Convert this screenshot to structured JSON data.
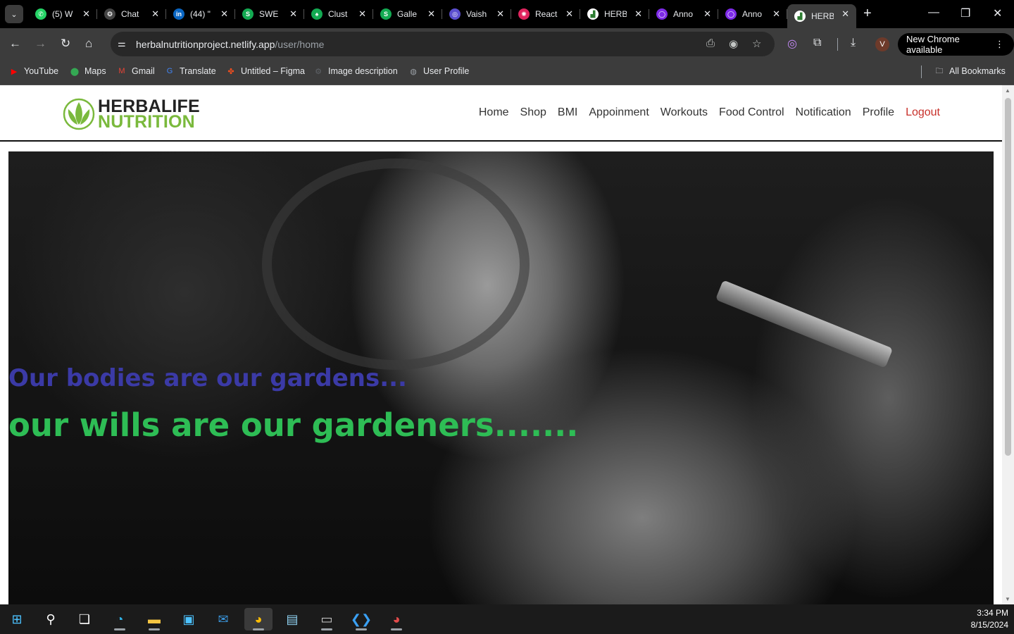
{
  "browser": {
    "tabs": [
      {
        "title": "(5) W",
        "icon": "whatsapp-icon",
        "color": "#25d366",
        "glyph": "✆"
      },
      {
        "title": "Chat",
        "icon": "chatgpt-icon",
        "color": "#444444",
        "glyph": "❂"
      },
      {
        "title": "(44) \"",
        "icon": "linkedin-icon",
        "color": "#0a66c2",
        "glyph": "in"
      },
      {
        "title": "SWE",
        "icon": "mongodb-leaf-icon",
        "color": "#13aa52",
        "glyph": "S"
      },
      {
        "title": "Clust",
        "icon": "mongodb-leaf-icon",
        "color": "#13aa52",
        "glyph": "♠"
      },
      {
        "title": "Galle",
        "icon": "mongodb-leaf-icon",
        "color": "#13aa52",
        "glyph": "S"
      },
      {
        "title": "Vaish",
        "icon": "logo-icon",
        "color": "#5b4fcf",
        "glyph": "◎"
      },
      {
        "title": "React",
        "icon": "react-icon",
        "color": "#e0245e",
        "glyph": "✺"
      },
      {
        "title": "HERB",
        "icon": "herbalife-favicon",
        "color": "#ffffff",
        "glyph": "▟"
      },
      {
        "title": "Anno",
        "icon": "canva-icon",
        "color": "#7d2ae8",
        "glyph": "◯"
      },
      {
        "title": "Anno",
        "icon": "canva-icon",
        "color": "#7d2ae8",
        "glyph": "◯"
      },
      {
        "title": "HERB",
        "icon": "herbalife-favicon",
        "color": "#ffffff",
        "glyph": "▟",
        "active": true
      }
    ],
    "url_host": "herbalnutritionproject.netlify.app",
    "url_path": "/user/home",
    "profile_initial": "V",
    "new_chrome_label": "New Chrome available",
    "bookmarks": [
      {
        "label": "YouTube",
        "icon": "youtube-icon",
        "color": "#ff0000",
        "glyph": "▶"
      },
      {
        "label": "Maps",
        "icon": "maps-icon",
        "color": "#34a853",
        "glyph": "⬤"
      },
      {
        "label": "Gmail",
        "icon": "gmail-icon",
        "color": "#ea4335",
        "glyph": "M"
      },
      {
        "label": "Translate",
        "icon": "translate-icon",
        "color": "#4285f4",
        "glyph": "G"
      },
      {
        "label": "Untitled – Figma",
        "icon": "figma-icon",
        "color": "#f24e1e",
        "glyph": "✤"
      },
      {
        "label": "Image description",
        "icon": "settings-icon",
        "color": "#5f6368",
        "glyph": "⚙"
      },
      {
        "label": "User Profile",
        "icon": "globe-icon",
        "color": "#9aa0a6",
        "glyph": "◍"
      }
    ],
    "all_bookmarks_label": "All Bookmarks"
  },
  "site": {
    "logo_line1": "HERBALIFE",
    "logo_line2": "NUTRITION",
    "nav": [
      "Home",
      "Shop",
      "BMI",
      "Appoinment",
      "Workouts",
      "Food Control",
      "Notification",
      "Profile",
      "Logout"
    ],
    "hero_quote_1": "Our bodies are our gardens...",
    "hero_quote_2": "our wills are our gardeners.......",
    "colors": {
      "quote1": "#3b3aa6",
      "quote2": "#2ebd55",
      "logout": "#c8302a",
      "brand_green": "#7ab93c"
    }
  },
  "taskbar": {
    "apps": [
      "windows-start-icon",
      "search-icon",
      "task-view-icon",
      "edge-icon",
      "file-explorer-icon",
      "microsoft-store-icon",
      "mail-icon",
      "chrome-icon",
      "notepad-icon",
      "terminal-icon",
      "vscode-icon",
      "chrome-profile-icon"
    ],
    "time": "3:34 PM",
    "date": "8/15/2024"
  }
}
